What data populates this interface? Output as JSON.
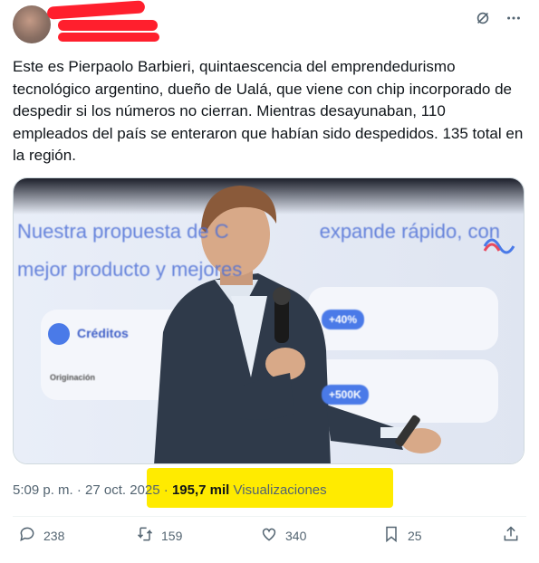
{
  "tweet": {
    "text": "Este es Pierpaolo Barbieri, quintaescencia del emprendedurismo tecnológico argentino, dueño de Ualá, que viene con chip incorporado de despedir si los números no cierran. Mientras desayunaban, 110 empleados del país se enteraron que habían sido despedidos. 135 total en la región.",
    "time": "5:09 p. m.",
    "separator": "·",
    "date": "27 oct. 2025",
    "views_count": "195,7 mil",
    "views_label": "Visualizaciones"
  },
  "media": {
    "slide_line1": "Nuestra propuesta de C",
    "slide_line1b": "expande rápido, con",
    "slide_line2": "mejor producto y mejores",
    "card_label": "Créditos",
    "card_sub": "Originación",
    "pill1": "+40%",
    "pill2": "+500K"
  },
  "actions": {
    "replies": "238",
    "reposts": "159",
    "likes": "340",
    "bookmarks": "25"
  },
  "icons": [
    "grok-icon",
    "more-icon",
    "reply-icon",
    "repost-icon",
    "like-icon",
    "bookmark-icon",
    "share-icon"
  ],
  "colors": {
    "highlight": "#ffeb00",
    "redaction": "#ff1f2d",
    "muted": "#536471"
  }
}
